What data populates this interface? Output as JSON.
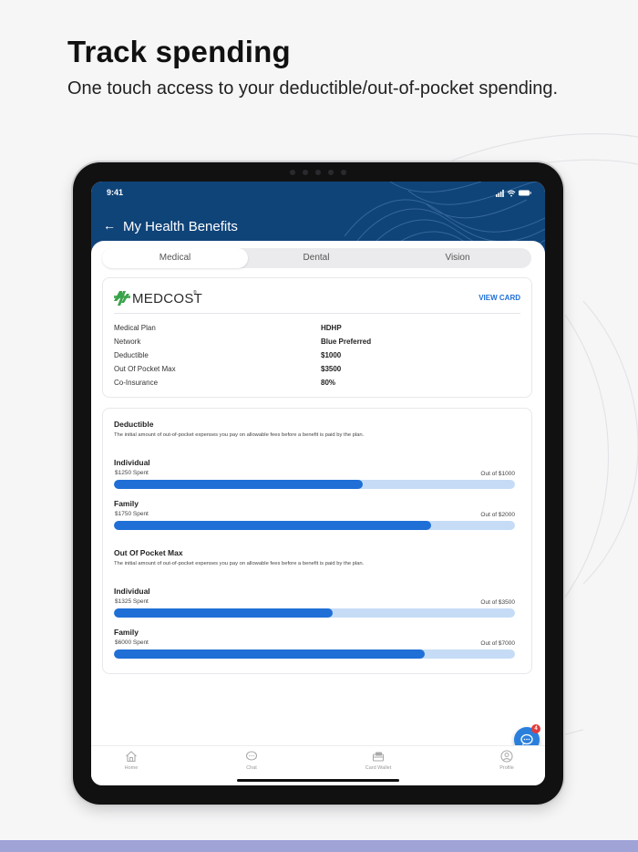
{
  "promo": {
    "title": "Track spending",
    "subtitle": "One touch access to your deductible/out-of-pocket spending."
  },
  "colors": {
    "header_bg": "#0f4479",
    "accent": "#1f6fd6",
    "bar_track": "#c6dcf6",
    "badge": "#e23b3b",
    "bottom_band": "#9fa3d6"
  },
  "status_bar": {
    "time": "9:41",
    "icons": [
      "signal-icon",
      "wifi-icon",
      "battery-icon"
    ]
  },
  "header": {
    "back_icon": "back-arrow-icon",
    "title": "My Health Benefits"
  },
  "tabs": [
    {
      "label": "Medical",
      "active": true
    },
    {
      "label": "Dental",
      "active": false
    },
    {
      "label": "Vision",
      "active": false
    }
  ],
  "plan": {
    "logo_text": "MEDCOST",
    "logo_tm": "®",
    "view_card": "VIEW CARD",
    "rows": [
      {
        "label": "Medical Plan",
        "value": "HDHP"
      },
      {
        "label": "Network",
        "value": "Blue Preferred"
      },
      {
        "label": "Deductible",
        "value": "$1000"
      },
      {
        "label": "Out Of Pocket Max",
        "value": "$3500"
      },
      {
        "label": "Co-Insurance",
        "value": "80%"
      }
    ]
  },
  "deductible": {
    "title": "Deductible",
    "description": "The initial amount of out-of-pocket expenses you pay on allowable fees before a benefit is paid by the plan.",
    "individual": {
      "label": "Individual",
      "spent": "$1250 Spent",
      "out_of": "Out of $1000",
      "fill": 0.62
    },
    "family": {
      "label": "Family",
      "spent": "$1750 Spent",
      "out_of": "Out of $2000",
      "fill": 0.79
    }
  },
  "oop": {
    "title": "Out Of Pocket Max",
    "description": "The initial amount of out-of-pocket expenses you pay on allowable fees before a benefit is paid by the plan.",
    "individual": {
      "label": "Individual",
      "spent": "$1325 Spent",
      "out_of": "Out of $3500",
      "fill": 0.545
    },
    "family": {
      "label": "Family",
      "spent": "$6000 Spent",
      "out_of": "Out of $7000",
      "fill": 0.775
    }
  },
  "chat": {
    "badge": "4",
    "icon": "chat-bubble-icon"
  },
  "nav": [
    {
      "label": "Home",
      "icon": "home-icon"
    },
    {
      "label": "Chat",
      "icon": "chat-icon"
    },
    {
      "label": "Card Wallet",
      "icon": "card-wallet-icon"
    },
    {
      "label": "Profile",
      "icon": "profile-icon"
    }
  ]
}
